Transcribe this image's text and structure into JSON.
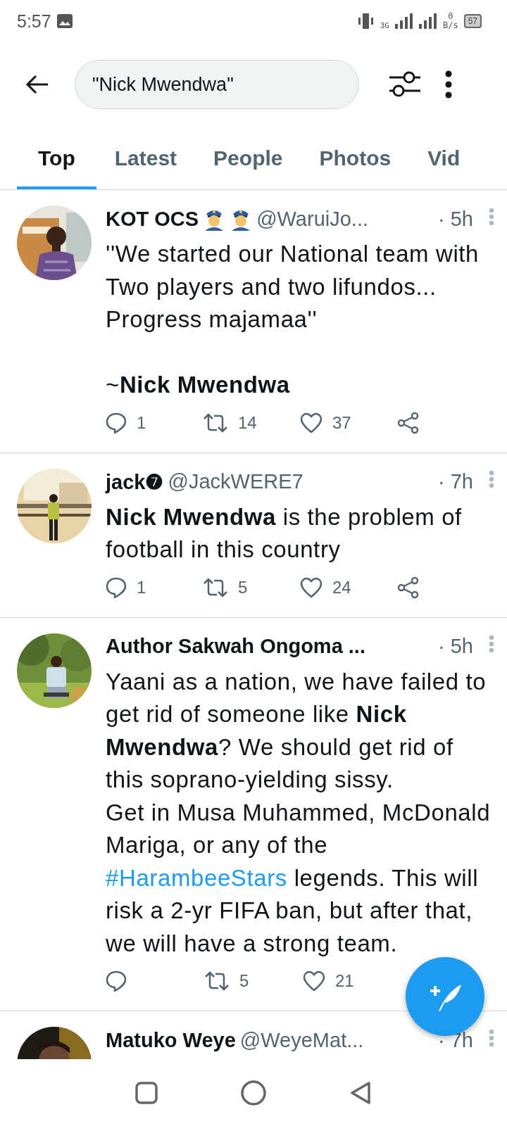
{
  "status_bar": {
    "time": "5:57",
    "network": "3G",
    "speed_value": "0",
    "speed_unit": "B/s",
    "battery": "57"
  },
  "search": {
    "value": "\"Nick Mwendwa\""
  },
  "tabs": [
    {
      "label": "Top",
      "selected": true
    },
    {
      "label": "Latest",
      "selected": false
    },
    {
      "label": "People",
      "selected": false
    },
    {
      "label": "Photos",
      "selected": false
    },
    {
      "label": "Vid",
      "selected": false
    }
  ],
  "tweets": [
    {
      "name": "KOT OCS",
      "name_icons": [
        {
          "kind": "officer"
        },
        {
          "kind": "officer"
        }
      ],
      "handle": "@WaruiJo...",
      "time": "· 5h",
      "body": [
        {
          "text": "''We started our National team with Two players and two lifundos...\nProgress majamaa''\n\n~**Nick Mwendwa**"
        }
      ],
      "replies": "1",
      "retweets": "14",
      "likes": "37",
      "avatar": {
        "kind": "picture"
      }
    },
    {
      "name": "jack❼",
      "handle": "@JackWERE7",
      "time": "· 7h",
      "body": [
        {
          "text": "**Nick Mwendwa** is the problem of football in this country"
        }
      ],
      "replies": "1",
      "retweets": "5",
      "likes": "24",
      "avatar": {
        "kind": "picture"
      }
    },
    {
      "name": "Author Sakwah Ongoma ...",
      "time": "· 5h",
      "body": [
        {
          "text": "Yaani as a nation, we have failed to get rid of someone like **Nick Mwendwa**? We should get rid of this soprano-yielding sissy.\nGet in Musa Muhammed, McDonald Mariga, or any of the "
        },
        {
          "link": "#HarambeeStars"
        },
        {
          "text": " legends. This will risk a 2-yr FIFA ban, but after that, we will have a strong team."
        }
      ],
      "retweets": "5",
      "likes": "21",
      "share_covered": true,
      "avatar": {
        "kind": "picture"
      }
    },
    {
      "name": "Matuko Weye",
      "handle": "@WeyeMat...",
      "time": "· 7h",
      "avatar": {
        "kind": "picture"
      }
    }
  ]
}
